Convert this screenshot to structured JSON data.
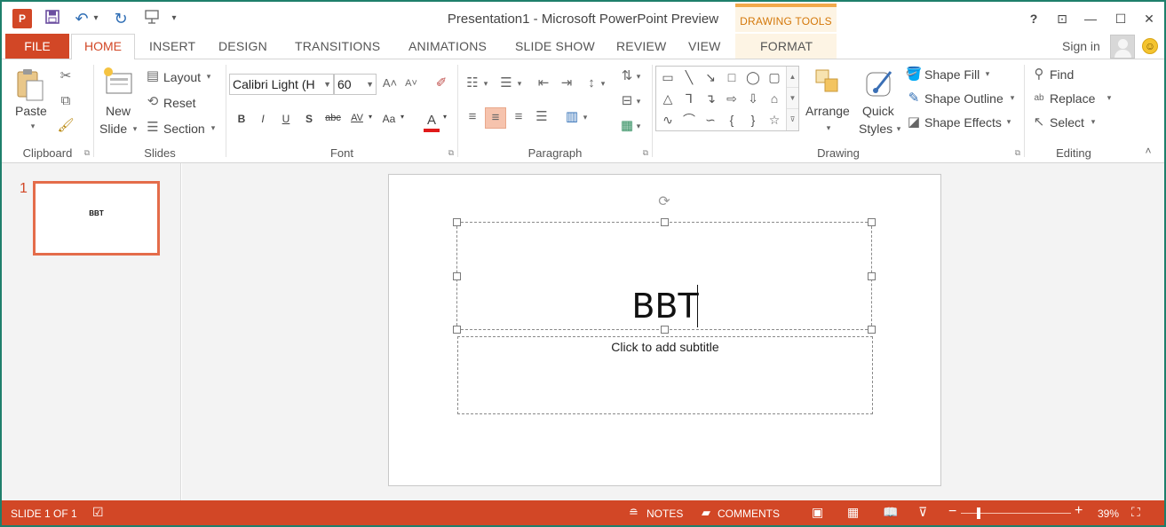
{
  "app": {
    "title": "Presentation1 - Microsoft PowerPoint Preview",
    "brand_color": "#d24726"
  },
  "quick_access": {
    "app_icon": "powerpoint-logo-icon",
    "icons": [
      "save-icon",
      "undo-icon",
      "redo-icon",
      "start-from-beginning-icon",
      "customize-qat-icon"
    ],
    "glyphs": {
      "undo_arrow": "▾",
      "customize": "▾"
    }
  },
  "window_controls": {
    "help": "?",
    "restore_ribbon": "⊡",
    "minimize": "—",
    "maximize": "☐",
    "close": "✕"
  },
  "contextual_tab": {
    "header": "DRAWING TOOLS",
    "tab": "FORMAT"
  },
  "tabs": {
    "file": "FILE",
    "home": "HOME",
    "insert": "INSERT",
    "design": "DESIGN",
    "transitions": "TRANSITIONS",
    "animations": "ANIMATIONS",
    "slide_show": "SLIDE SHOW",
    "review": "REVIEW",
    "view": "VIEW"
  },
  "account": {
    "sign_in": "Sign in"
  },
  "ribbon": {
    "clipboard": {
      "label": "Clipboard",
      "paste": "Paste"
    },
    "slides": {
      "label": "Slides",
      "new_slide_line1": "New",
      "new_slide_line2": "Slide",
      "layout": "Layout",
      "reset": "Reset",
      "section": "Section"
    },
    "font": {
      "label": "Font",
      "font_name": "Calibri Light (H",
      "font_size": "60",
      "bold": "B",
      "italic": "I",
      "underline": "U",
      "shadow": "S",
      "strike": "abc",
      "spacing": "AV",
      "case": "Aa",
      "color": "A"
    },
    "paragraph": {
      "label": "Paragraph"
    },
    "drawing": {
      "label": "Drawing",
      "arrange": "Arrange",
      "quick_styles_line1": "Quick",
      "quick_styles_line2": "Styles",
      "shape_fill": "Shape Fill",
      "shape_outline": "Shape Outline",
      "shape_effects": "Shape Effects"
    },
    "editing": {
      "label": "Editing",
      "find": "Find",
      "replace": "Replace",
      "select": "Select"
    }
  },
  "thumbnails": [
    {
      "number": "1",
      "text": "BBT"
    }
  ],
  "slide": {
    "title": "BBT",
    "subtitle_placeholder": "Click to add subtitle"
  },
  "status_bar": {
    "slide_info": "SLIDE 1 OF 1",
    "notes": "NOTES",
    "comments": "COMMENTS",
    "zoom": "39%",
    "zoom_fraction": 0.39
  }
}
